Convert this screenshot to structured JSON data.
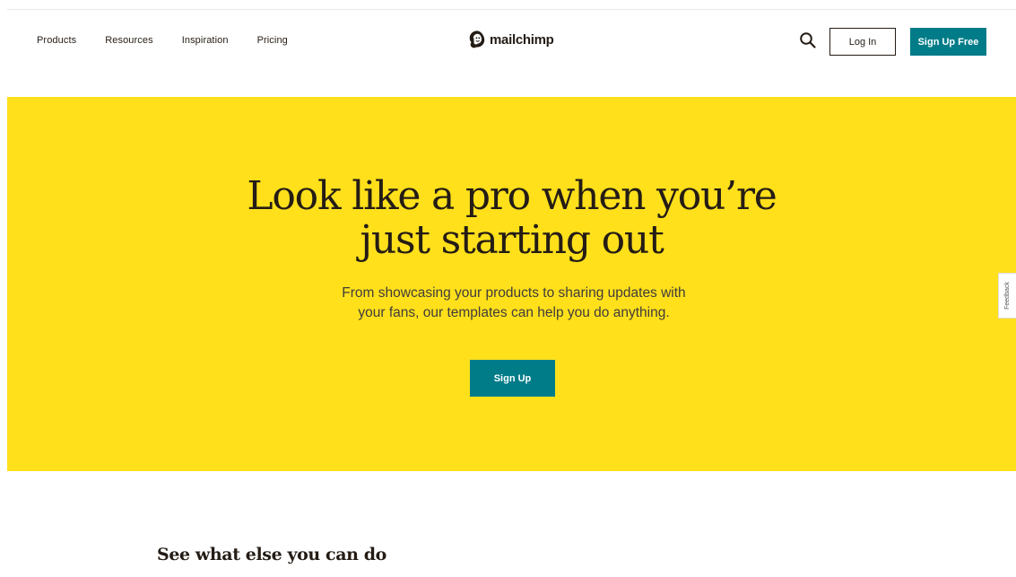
{
  "header": {
    "nav": [
      "Products",
      "Resources",
      "Inspiration",
      "Pricing"
    ],
    "logo_text": "mailchimp",
    "logo_icon": "freddie-chimp-icon",
    "search_icon": "search-icon",
    "login_label": "Log In",
    "signup_free_label": "Sign Up Free"
  },
  "hero": {
    "title_line1": "Look like a pro when you’re",
    "title_line2": "just starting out",
    "subtitle": "From showcasing your products to sharing updates with your fans, our templates can help you do anything.",
    "cta_label": "Sign Up"
  },
  "feedback_label": "Feedback",
  "section": {
    "heading": "See what else you can do"
  },
  "colors": {
    "hero_background": "#ffe01b",
    "primary_button": "#007c89",
    "text": "#241c15"
  }
}
